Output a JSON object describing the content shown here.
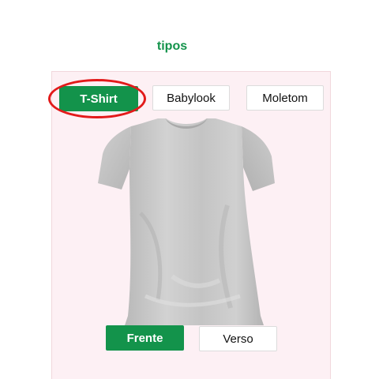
{
  "section": {
    "title": "tipos"
  },
  "types": [
    {
      "label": "T-Shirt",
      "selected": true
    },
    {
      "label": "Babylook",
      "selected": false
    },
    {
      "label": "Moletom",
      "selected": false
    }
  ],
  "views": [
    {
      "label": "Frente",
      "selected": true
    },
    {
      "label": "Verso",
      "selected": false
    }
  ],
  "preview": {
    "icon": "tshirt-front-image"
  },
  "colors": {
    "accent": "#13934b",
    "panel_bg": "#fdf0f4",
    "highlight": "#e21a1a",
    "shirt": "#c8c8c8"
  }
}
